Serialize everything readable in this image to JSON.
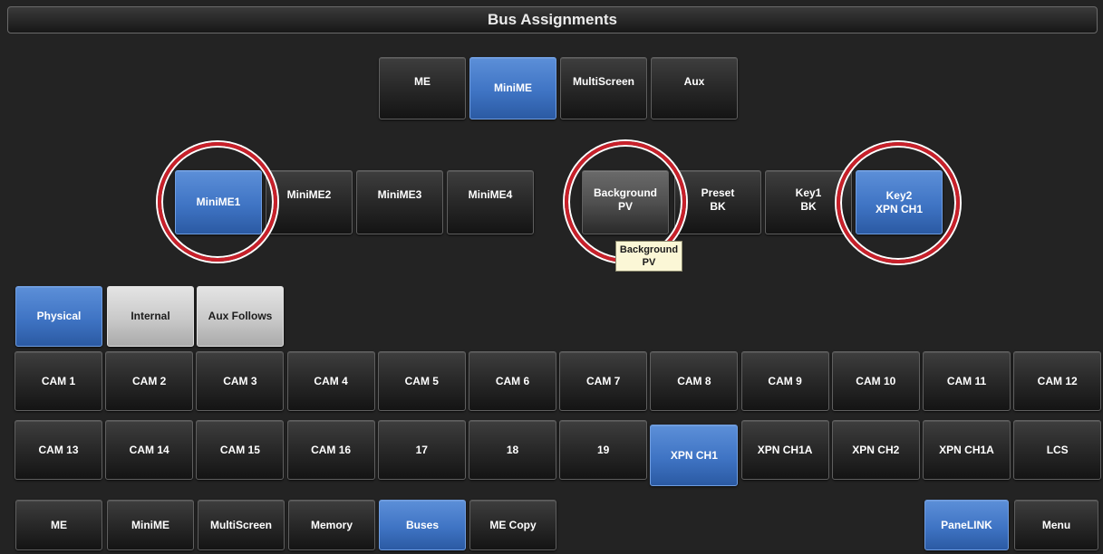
{
  "title": "Bus Assignments",
  "mode_tabs": [
    {
      "label": "ME",
      "active": false
    },
    {
      "label": "MiniME",
      "active": true
    },
    {
      "label": "MultiScreen",
      "active": false
    },
    {
      "label": "Aux",
      "active": false
    }
  ],
  "minime_tabs": [
    {
      "label": "MiniME1",
      "active": true
    },
    {
      "label": "MiniME2",
      "active": false
    },
    {
      "label": "MiniME3",
      "active": false
    },
    {
      "label": "MiniME4",
      "active": false
    }
  ],
  "bus_tabs": [
    {
      "label": "Background\nPV",
      "active": false
    },
    {
      "label": "Preset\nBK",
      "active": false
    },
    {
      "label": "Key1\nBK",
      "active": false
    },
    {
      "label": "Key2\nXPN CH1",
      "active": true
    }
  ],
  "tooltip": "Background\nPV",
  "source_types": [
    {
      "label": "Physical",
      "active": true
    },
    {
      "label": "Internal",
      "active": false
    },
    {
      "label": "Aux Follows",
      "active": false
    }
  ],
  "sources_row1": [
    "CAM 1",
    "CAM 2",
    "CAM 3",
    "CAM 4",
    "CAM 5",
    "CAM 6",
    "CAM 7",
    "CAM 8",
    "CAM 9",
    "CAM 10",
    "CAM 11",
    "CAM 12"
  ],
  "sources_row2": [
    "CAM 13",
    "CAM 14",
    "CAM 15",
    "CAM 16",
    "17",
    "18",
    "19",
    "XPN CH1",
    "XPN CH1A",
    "XPN CH2",
    "XPN CH1A",
    "LCS"
  ],
  "selected_source": "XPN CH1",
  "bottom_nav": [
    {
      "label": "ME",
      "active": false
    },
    {
      "label": "MiniME",
      "active": false
    },
    {
      "label": "MultiScreen",
      "active": false
    },
    {
      "label": "Memory",
      "active": false
    },
    {
      "label": "Buses",
      "active": true
    },
    {
      "label": "ME Copy",
      "active": false
    }
  ],
  "panelink_label": "PaneLINK",
  "menu_label": "Menu",
  "colors": {
    "background": "#232323",
    "selected_blue": "#3f74c4",
    "highlight_ring": "#c8202a",
    "tooltip_bg": "#fbf7d6"
  }
}
